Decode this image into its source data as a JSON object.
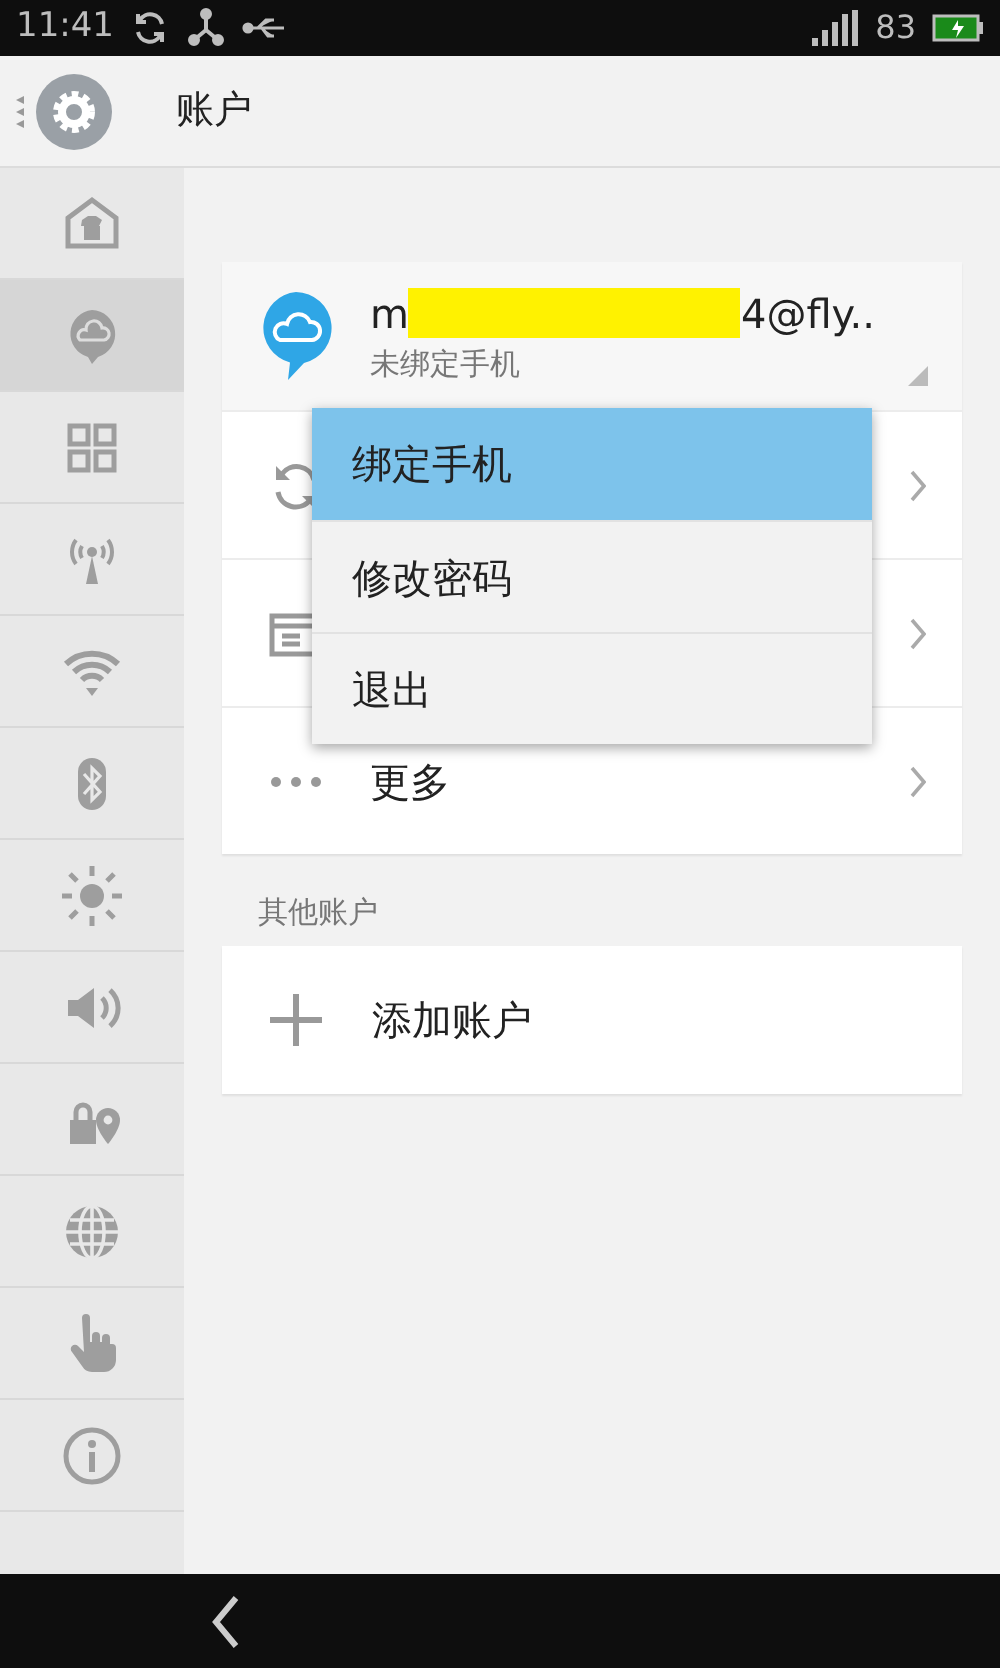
{
  "status_bar": {
    "time": "11:41",
    "battery": "83"
  },
  "header": {
    "title": "账户"
  },
  "sidebar": {
    "items": [
      {
        "kind": "theme",
        "selected": false
      },
      {
        "kind": "cloud",
        "selected": true
      },
      {
        "kind": "apps",
        "selected": false
      },
      {
        "kind": "antenna",
        "selected": false
      },
      {
        "kind": "wifi",
        "selected": false
      },
      {
        "kind": "bluetooth",
        "selected": false
      },
      {
        "kind": "brightness",
        "selected": false
      },
      {
        "kind": "sound",
        "selected": false
      },
      {
        "kind": "privacy",
        "selected": false
      },
      {
        "kind": "language",
        "selected": false
      },
      {
        "kind": "gesture",
        "selected": false
      },
      {
        "kind": "info",
        "selected": false
      }
    ]
  },
  "account": {
    "name_start": "m",
    "name_end": "4@fly..",
    "status": "未绑定手机",
    "rows": [
      {
        "kind": "sync"
      },
      {
        "kind": "card"
      },
      {
        "kind": "more",
        "label": "更多"
      }
    ]
  },
  "other_accounts": {
    "heading": "其他账户",
    "add_label": "添加账户"
  },
  "menu": {
    "items": [
      {
        "label": "绑定手机",
        "selected": true
      },
      {
        "label": "修改密码",
        "selected": false
      },
      {
        "label": "退出",
        "selected": false
      }
    ]
  }
}
